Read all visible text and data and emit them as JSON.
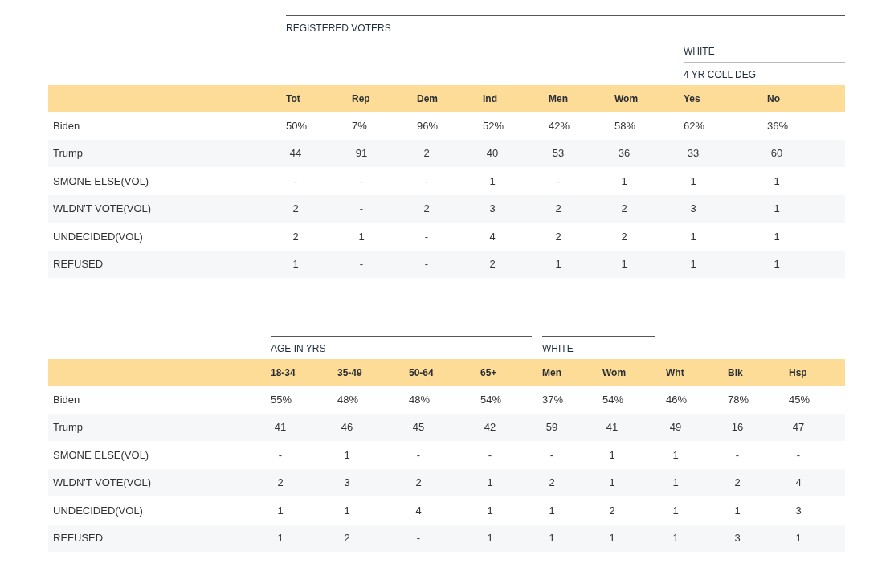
{
  "tables": [
    {
      "group_headings": [
        "REGISTERED VOTERS",
        "WHITE",
        "4 YR COLL DEG"
      ],
      "columns": [
        "Tot",
        "Rep",
        "Dem",
        "Ind",
        "Men",
        "Wom",
        "Yes",
        "No"
      ],
      "rows": [
        {
          "label": "Biden",
          "cells": [
            "50%",
            "7%",
            "96%",
            "52%",
            "42%",
            "58%",
            "62%",
            "36%"
          ]
        },
        {
          "label": "Trump",
          "cells": [
            "44",
            "91",
            "2",
            "40",
            "53",
            "36",
            "33",
            "60"
          ]
        },
        {
          "label": "SMONE ELSE(VOL)",
          "cells": [
            "-",
            "-",
            "-",
            "1",
            "-",
            "1",
            "1",
            "1"
          ]
        },
        {
          "label": "WLDN'T VOTE(VOL)",
          "cells": [
            "2",
            "-",
            "2",
            "3",
            "2",
            "2",
            "3",
            "1"
          ]
        },
        {
          "label": "UNDECIDED(VOL)",
          "cells": [
            "2",
            "1",
            "-",
            "4",
            "2",
            "2",
            "1",
            "1"
          ]
        },
        {
          "label": "REFUSED",
          "cells": [
            "1",
            "-",
            "-",
            "2",
            "1",
            "1",
            "1",
            "1"
          ]
        }
      ]
    },
    {
      "group_headings": [
        "AGE IN YRS",
        "WHITE"
      ],
      "columns": [
        "18-34",
        "35-49",
        "50-64",
        "65+",
        "Men",
        "Wom",
        "Wht",
        "Blk",
        "Hsp"
      ],
      "rows": [
        {
          "label": "Biden",
          "cells": [
            "55%",
            "48%",
            "48%",
            "54%",
            "37%",
            "54%",
            "46%",
            "78%",
            "45%"
          ]
        },
        {
          "label": "Trump",
          "cells": [
            "41",
            "46",
            "45",
            "42",
            "59",
            "41",
            "49",
            "16",
            "47"
          ]
        },
        {
          "label": "SMONE ELSE(VOL)",
          "cells": [
            "-",
            "1",
            "-",
            "-",
            "-",
            "1",
            "1",
            "-",
            "-"
          ]
        },
        {
          "label": "WLDN'T VOTE(VOL)",
          "cells": [
            "2",
            "3",
            "2",
            "1",
            "2",
            "1",
            "1",
            "2",
            "4"
          ]
        },
        {
          "label": "UNDECIDED(VOL)",
          "cells": [
            "1",
            "1",
            "4",
            "1",
            "1",
            "2",
            "1",
            "1",
            "3"
          ]
        },
        {
          "label": "REFUSED",
          "cells": [
            "1",
            "2",
            "-",
            "1",
            "1",
            "1",
            "1",
            "3",
            "1"
          ]
        }
      ]
    }
  ]
}
